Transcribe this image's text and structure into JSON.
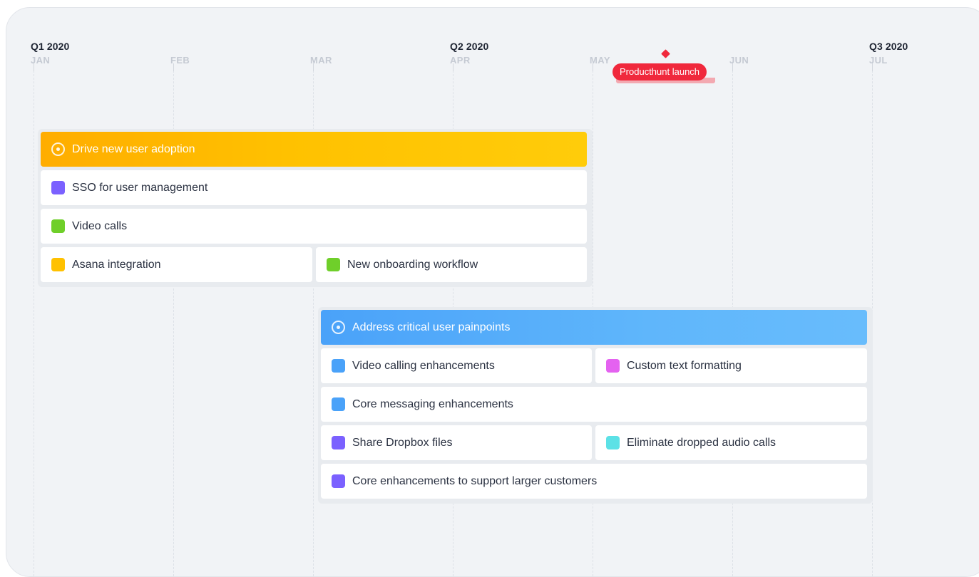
{
  "timeline": {
    "quarters": [
      {
        "label": "Q1 2020"
      },
      {
        "label": "Q2 2020"
      },
      {
        "label": "Q3 2020"
      }
    ],
    "months": [
      "JAN",
      "FEB",
      "MAR",
      "APR",
      "MAY",
      "JUN",
      "JUL"
    ]
  },
  "milestone": {
    "label": "Producthunt launch",
    "color": "#f0283c"
  },
  "objectives": [
    {
      "title": "Drive new user adoption",
      "color": "#ffb800",
      "icon": "target-icon",
      "items": [
        {
          "label": "SSO for user management",
          "color": "#7b61ff"
        },
        {
          "label": "Video calls",
          "color": "#6fcf2a"
        },
        {
          "label": "Asana integration",
          "color": "#ffc100"
        },
        {
          "label": "New onboarding workflow",
          "color": "#6fcf2a"
        }
      ]
    },
    {
      "title": "Address critical user painpoints",
      "color": "#5aaefa",
      "icon": "target-icon",
      "items": [
        {
          "label": "Video calling enhancements",
          "color": "#4aa2f9"
        },
        {
          "label": "Custom text formatting",
          "color": "#e462f0"
        },
        {
          "label": "Core messaging enhancements",
          "color": "#4aa2f9"
        },
        {
          "label": "Share Dropbox files",
          "color": "#7b61ff"
        },
        {
          "label": "Eliminate dropped audio calls",
          "color": "#5ce1e6"
        },
        {
          "label": "Core enhancements to support larger customers",
          "color": "#7b61ff"
        }
      ]
    }
  ]
}
